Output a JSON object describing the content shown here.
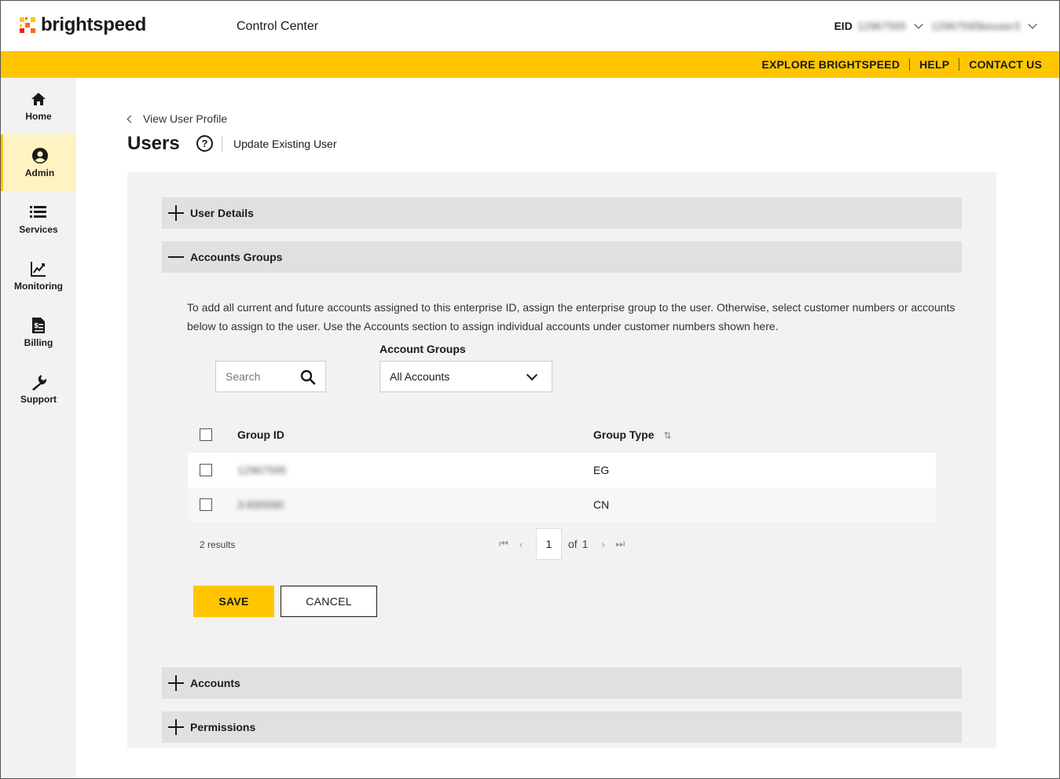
{
  "header": {
    "brand": "brightspeed",
    "app_title": "Control Center",
    "eid_label": "EID",
    "eid_value": "12967595",
    "user_value": "12967595bouser3"
  },
  "utility_nav": {
    "items": [
      "EXPLORE BRIGHTSPEED",
      "HELP",
      "CONTACT US"
    ]
  },
  "sidebar": {
    "items": [
      {
        "label": "Home",
        "icon": "home-icon"
      },
      {
        "label": "Admin",
        "icon": "user-circle-icon",
        "active": true
      },
      {
        "label": "Services",
        "icon": "list-icon"
      },
      {
        "label": "Monitoring",
        "icon": "chart-icon"
      },
      {
        "label": "Billing",
        "icon": "invoice-icon"
      },
      {
        "label": "Support",
        "icon": "wrench-icon"
      }
    ]
  },
  "page": {
    "back_link": "View User Profile",
    "title": "Users",
    "subtitle": "Update Existing User"
  },
  "sections": {
    "user_details": "User Details",
    "accounts_groups": "Accounts Groups",
    "accounts": "Accounts",
    "permissions": "Permissions"
  },
  "accounts_groups": {
    "description": "To add all current and future accounts assigned to this enterprise ID, assign the enterprise group to the user. Otherwise, select customer numbers or accounts below to assign to the user. Use the Accounts section to assign individual accounts under customer numbers shown here.",
    "search_placeholder": "Search",
    "filter_label": "Account Groups",
    "filter_value": "All Accounts",
    "table": {
      "columns": [
        "Group ID",
        "Group Type"
      ],
      "rows": [
        {
          "group_id": "12967595",
          "group_type": "EG"
        },
        {
          "group_id": "3-830090",
          "group_type": "CN"
        }
      ]
    },
    "results_text": "2 results",
    "pagination": {
      "current": "1",
      "of_text": "of",
      "total": "1"
    },
    "save_label": "SAVE",
    "cancel_label": "CANCEL"
  },
  "colors": {
    "brand_yellow": "#ffc600",
    "panel_bg": "#f2f2f2",
    "accordion_bg": "#e0e0e1"
  }
}
